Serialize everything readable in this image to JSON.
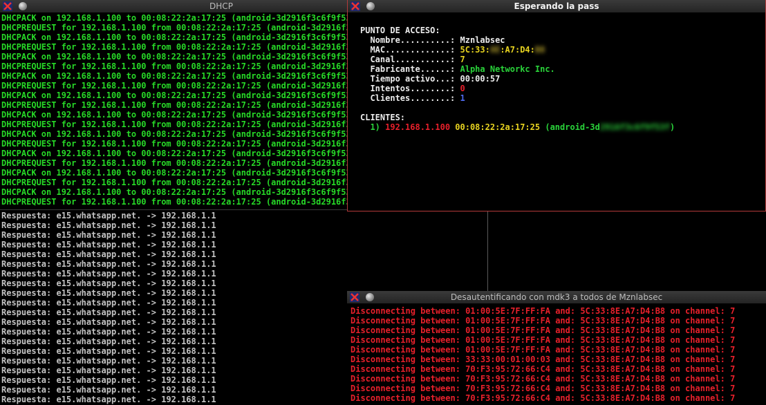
{
  "dhcp": {
    "title": "DHCP",
    "lines": [
      "DHCPACK on 192.168.1.100 to 00:08:22:2a:17:25 (android-3d2916f3c6f9f53f)",
      "DHCPREQUEST for 192.168.1.100 from 00:08:22:2a:17:25 (android-3d2916f3c6",
      "DHCPACK on 192.168.1.100 to 00:08:22:2a:17:25 (android-3d2916f3c6f9f53f)",
      "DHCPREQUEST for 192.168.1.100 from 00:08:22:2a:17:25 (android-3d2916f3c6",
      "DHCPACK on 192.168.1.100 to 00:08:22:2a:17:25 (android-3d2916f3c6f9f53f)",
      "DHCPREQUEST for 192.168.1.100 from 00:08:22:2a:17:25 (android-3d2916f3c6",
      "DHCPACK on 192.168.1.100 to 00:08:22:2a:17:25 (android-3d2916f3c6f9f53f)",
      "DHCPREQUEST for 192.168.1.100 from 00:08:22:2a:17:25 (android-3d2916f3c6",
      "DHCPACK on 192.168.1.100 to 00:08:22:2a:17:25 (android-3d2916f3c6f9f53f)",
      "DHCPREQUEST for 192.168.1.100 from 00:08:22:2a:17:25 (android-3d2916f3c6",
      "DHCPACK on 192.168.1.100 to 00:08:22:2a:17:25 (android-3d2916f3c6f9f53f)",
      "DHCPREQUEST for 192.168.1.100 from 00:08:22:2a:17:25 (android-3d2916f3c6",
      "DHCPACK on 192.168.1.100 to 00:08:22:2a:17:25 (android-3d2916f3c6f9f53f)",
      "DHCPREQUEST for 192.168.1.100 from 00:08:22:2a:17:25 (android-3d2916f3c6",
      "DHCPACK on 192.168.1.100 to 00:08:22:2a:17:25 (android-3d2916f3c6f9f53f)",
      "DHCPREQUEST for 192.168.1.100 from 00:08:22:2a:17:25 (android-3d2916f3c6",
      "DHCPACK on 192.168.1.100 to 00:08:22:2a:17:25 (android-3d2916f3c6f9f53f)",
      "DHCPREQUEST for 192.168.1.100 from 00:08:22:2a:17:25 (android-3d2916f3c6",
      "DHCPACK on 192.168.1.100 to 00:08:22:2a:17:25 (android-3d2916f3c6f9f53f)",
      "DHCPREQUEST for 192.168.1.100 from 00:08:22:2a:17:25 (android-3d2916f3c6"
    ]
  },
  "dns": {
    "lines": [
      "Respuesta: e15.whatsapp.net. -> 192.168.1.1",
      "Respuesta: e15.whatsapp.net. -> 192.168.1.1",
      "Respuesta: e15.whatsapp.net. -> 192.168.1.1",
      "Respuesta: e15.whatsapp.net. -> 192.168.1.1",
      "Respuesta: e15.whatsapp.net. -> 192.168.1.1",
      "Respuesta: e15.whatsapp.net. -> 192.168.1.1",
      "Respuesta: e15.whatsapp.net. -> 192.168.1.1",
      "Respuesta: e15.whatsapp.net. -> 192.168.1.1",
      "Respuesta: e15.whatsapp.net. -> 192.168.1.1",
      "Respuesta: e15.whatsapp.net. -> 192.168.1.1",
      "Respuesta: e15.whatsapp.net. -> 192.168.1.1",
      "Respuesta: e15.whatsapp.net. -> 192.168.1.1",
      "Respuesta: e15.whatsapp.net. -> 192.168.1.1",
      "Respuesta: e15.whatsapp.net. -> 192.168.1.1",
      "Respuesta: e15.whatsapp.net. -> 192.168.1.1",
      "Respuesta: e15.whatsapp.net. -> 192.168.1.1",
      "Respuesta: e15.whatsapp.net. -> 192.168.1.1",
      "Respuesta: e15.whatsapp.net. -> 192.168.1.1",
      "Respuesta: e15.whatsapp.net. -> 192.168.1.1",
      "Respuesta: e15.whatsapp.net. -> 192.168.1.1"
    ]
  },
  "pass": {
    "title": "Esperando la pass",
    "ap_header": "PUNTO DE ACCESO:",
    "name_label": "  Nombre..........: ",
    "name_value": "Mznlabsec",
    "mac_label": "  MAC.............: ",
    "mac_part1": "5C:33:",
    "mac_blur1": "8E",
    "mac_part2": ":A7:D4:",
    "mac_blur2": "B8",
    "channel_label": "  Canal...........: ",
    "channel_value": "7",
    "vendor_label": "  Fabricante......: ",
    "vendor_value": "Alpha Networkc Inc.",
    "uptime_label": "  Tiempo activo...: ",
    "uptime_value": "00:00:57",
    "attempts_label": "  Intentos........: ",
    "attempts_value": "0",
    "clients_label": "  Clientes........: ",
    "clients_value": "1",
    "clients_header": "CLIENTES:",
    "client_index": "  1) ",
    "client_ip": "192.168.1.100",
    "client_mac": "00:08:22:2a:17:25",
    "client_host_prefix": "(android-3d",
    "client_host_blur": "2916f3c6f9f53f",
    "client_host_suffix": ")"
  },
  "mdk3": {
    "title": "Desautentificando con mdk3 a todos de Mznlabsec",
    "lines": [
      "Disconnecting between: 01:00:5E:7F:FF:FA and: 5C:33:8E:A7:D4:B8 on channel: 7",
      "Disconnecting between: 01:00:5E:7F:FF:FA and: 5C:33:8E:A7:D4:B8 on channel: 7",
      "Disconnecting between: 01:00:5E:7F:FF:FA and: 5C:33:8E:A7:D4:B8 on channel: 7",
      "Disconnecting between: 01:00:5E:7F:FF:FA and: 5C:33:8E:A7:D4:B8 on channel: 7",
      "Disconnecting between: 01:00:5E:7F:FF:FA and: 5C:33:8E:A7:D4:B8 on channel: 7",
      "Disconnecting between: 33:33:00:01:00:03 and: 5C:33:8E:A7:D4:B8 on channel: 7",
      "Disconnecting between: 70:F3:95:72:66:C4 and: 5C:33:8E:A7:D4:B8 on channel: 7",
      "Disconnecting between: 70:F3:95:72:66:C4 and: 5C:33:8E:A7:D4:B8 on channel: 7",
      "Disconnecting between: 70:F3:95:72:66:C4 and: 5C:33:8E:A7:D4:B8 on channel: 7",
      "Disconnecting between: 70:F3:95:72:66:C4 and: 5C:33:8E:A7:D4:B8 on channel: 7"
    ]
  }
}
